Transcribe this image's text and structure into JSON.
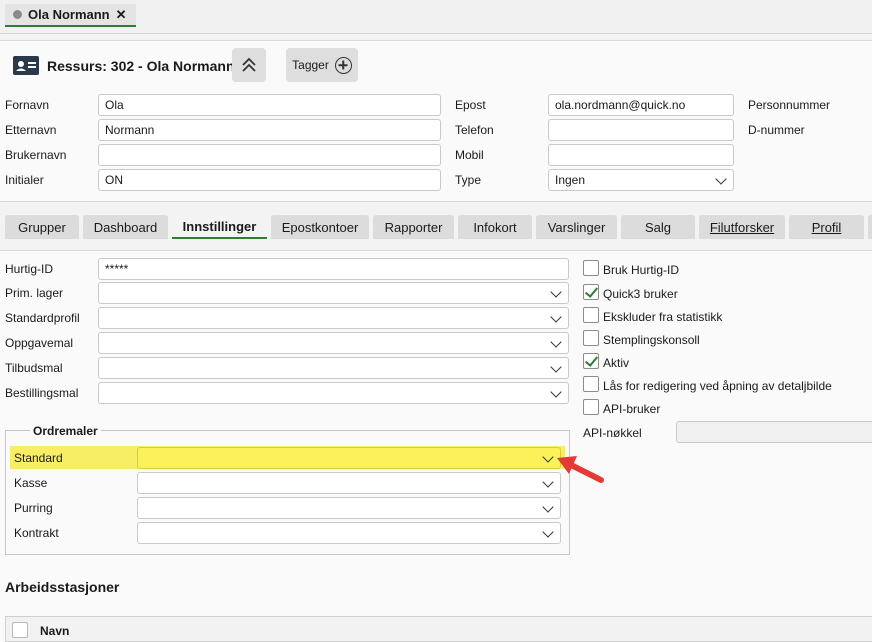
{
  "doc_tab": {
    "label": "Ola Normann",
    "close": "✕"
  },
  "header": {
    "title": "Ressurs: 302 - Ola Normann",
    "tags_label": "Tagger",
    "fields": {
      "fornavn": {
        "label": "Fornavn",
        "value": "Ola"
      },
      "etternavn": {
        "label": "Etternavn",
        "value": "Normann"
      },
      "brukernavn": {
        "label": "Brukernavn",
        "value": ""
      },
      "initialer": {
        "label": "Initialer",
        "value": "ON"
      },
      "epost": {
        "label": "Epost",
        "value": "ola.nordmann@quick.no"
      },
      "telefon": {
        "label": "Telefon",
        "value": ""
      },
      "mobil": {
        "label": "Mobil",
        "value": ""
      },
      "type": {
        "label": "Type",
        "value": "Ingen"
      },
      "personnummer": {
        "label": "Personnummer"
      },
      "dnummer": {
        "label": "D-nummer"
      }
    }
  },
  "tabs": [
    {
      "label": "Grupper"
    },
    {
      "label": "Dashboard"
    },
    {
      "label": "Innstillinger",
      "active": true
    },
    {
      "label": "Epostkontoer"
    },
    {
      "label": "Rapporter"
    },
    {
      "label": "Infokort"
    },
    {
      "label": "Varslinger"
    },
    {
      "label": "Salg"
    },
    {
      "label": "Filutforsker"
    },
    {
      "label": "Profil"
    }
  ],
  "settings": {
    "hurtig_id": {
      "label": "Hurtig-ID",
      "value": "*****"
    },
    "prim_lager": {
      "label": "Prim. lager",
      "value": ""
    },
    "standardprofil": {
      "label": "Standardprofil",
      "value": ""
    },
    "oppgavemal": {
      "label": "Oppgavemal",
      "value": ""
    },
    "tilbudsmal": {
      "label": "Tilbudsmal",
      "value": ""
    },
    "bestillingsmal": {
      "label": "Bestillingsmal",
      "value": ""
    }
  },
  "checkboxes": [
    {
      "label": "Bruk Hurtig-ID",
      "checked": false
    },
    {
      "label": "Quick3 bruker",
      "checked": true
    },
    {
      "label": "Ekskluder fra statistikk",
      "checked": false
    },
    {
      "label": "Stemplingskonsoll",
      "checked": false
    },
    {
      "label": "Aktiv",
      "checked": true
    },
    {
      "label": "Lås for redigering ved åpning av detaljbilde",
      "checked": false
    },
    {
      "label": "API-bruker",
      "checked": false
    }
  ],
  "api_key": {
    "label": "API-nøkkel",
    "value": ""
  },
  "ordremaler": {
    "title": "Ordremaler",
    "rows": [
      {
        "label": "Standard",
        "value": ""
      },
      {
        "label": "Kasse",
        "value": ""
      },
      {
        "label": "Purring",
        "value": ""
      },
      {
        "label": "Kontrakt",
        "value": ""
      }
    ]
  },
  "arbeidsstasjoner": {
    "title": "Arbeidsstasjoner",
    "columns": [
      "Navn"
    ]
  },
  "colors": {
    "accent_green": "#2e7d32",
    "highlight_yellow": "#f7ee66",
    "arrow_red": "#e53935"
  }
}
